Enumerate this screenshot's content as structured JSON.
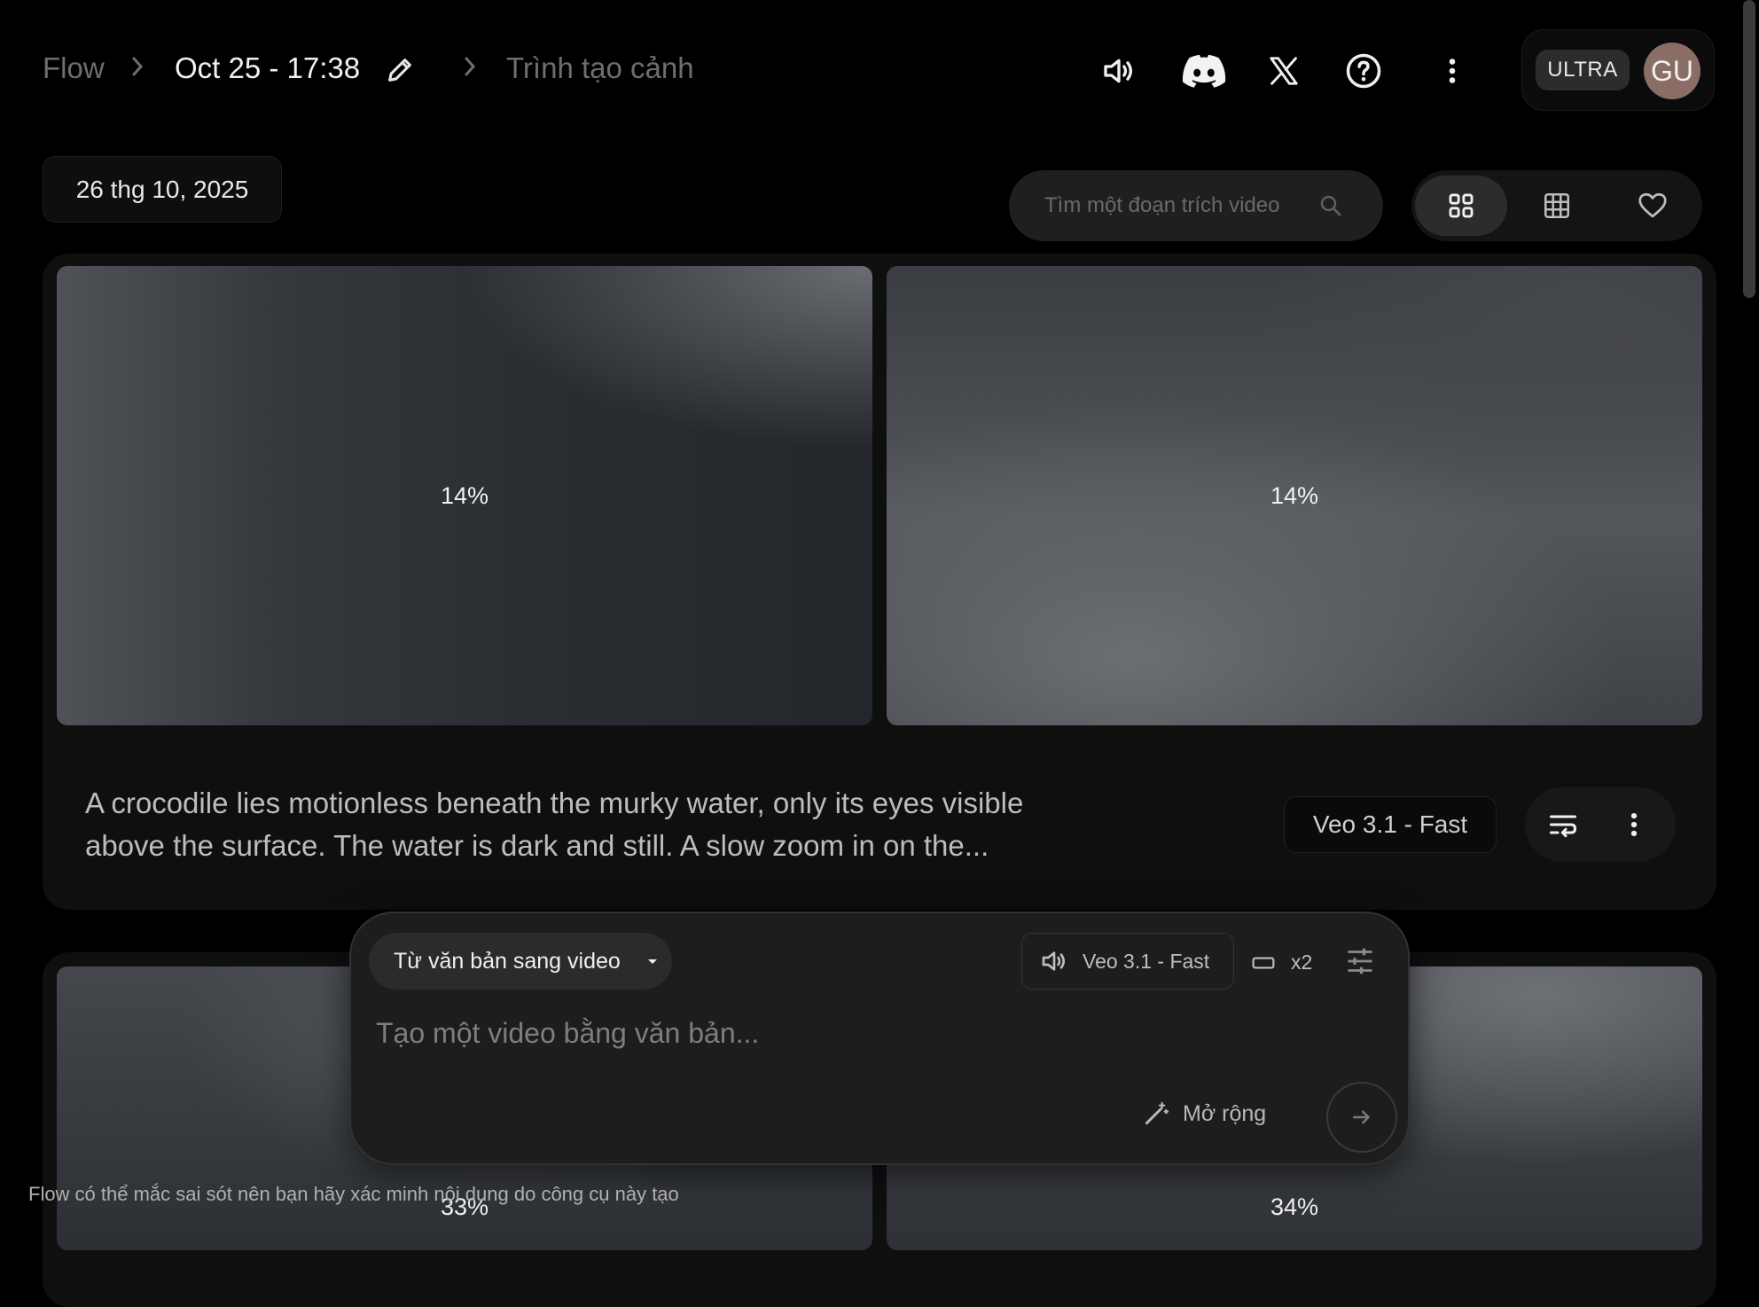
{
  "header": {
    "breadcrumb": [
      "Flow",
      "Oct 25 - 17:38",
      "Trình tạo cảnh"
    ],
    "account_badge": "ULTRA",
    "avatar_initials": "GU",
    "icons": [
      "volume-icon",
      "discord-icon",
      "x-icon",
      "help-icon",
      "more-vert-icon"
    ]
  },
  "toolbar": {
    "date": "26 thg 10, 2025",
    "search_placeholder": "Tìm một đoạn trích video",
    "view_modes": [
      "grid-large-icon",
      "grid-small-icon",
      "favorite-icon"
    ],
    "selected_view": "grid-large-icon"
  },
  "scene1": {
    "clips": [
      {
        "progress_label": "14%",
        "progress": 0.14
      },
      {
        "progress_label": "14%",
        "progress": 0.14
      }
    ],
    "prompt": "A crocodile lies motionless beneath the murky water, only its eyes visible above the surface. The water is dark and still. A slow zoom in on the...",
    "model": "Veo 3.1 - Fast"
  },
  "scene2": {
    "clips": [
      {
        "progress_label": "33%",
        "progress": 0.33
      },
      {
        "progress_label": "34%",
        "progress": 0.34
      }
    ]
  },
  "composer": {
    "mode": "Từ văn bản sang video",
    "model": "Veo 3.1 - Fast",
    "count": "x2",
    "placeholder": "Tạo một video bằng văn bản...",
    "expand_label": "Mở rộng"
  },
  "disclaimer": "Flow có thể mắc sai sót nên bạn hãy xác minh nội dung do công cụ này tạo"
}
